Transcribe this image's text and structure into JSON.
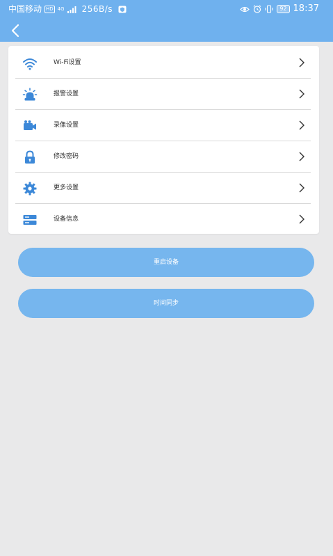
{
  "status_bar": {
    "carrier": "中国移动",
    "hd_badge": "HD",
    "network_type": "4G",
    "speed": "256B/s",
    "battery": "92",
    "time": "18:37"
  },
  "menu": {
    "items": [
      {
        "label": "Wi-Fi设置",
        "icon": "wifi-icon"
      },
      {
        "label": "报警设置",
        "icon": "alarm-light-icon"
      },
      {
        "label": "录像设置",
        "icon": "video-camera-icon"
      },
      {
        "label": "修改密码",
        "icon": "lock-icon"
      },
      {
        "label": "更多设置",
        "icon": "gear-icon"
      },
      {
        "label": "设备信息",
        "icon": "device-info-icon"
      }
    ]
  },
  "actions": {
    "reboot_label": "重启设备",
    "time_sync_label": "时间同步"
  },
  "colors": {
    "header": "#6fb1ee",
    "accent_icon": "#3c88d8",
    "button": "#76b6ee",
    "background": "#e9e9ea"
  }
}
